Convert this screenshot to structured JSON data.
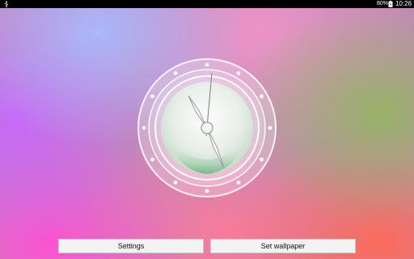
{
  "status_bar": {
    "usb_icon": "usb-icon",
    "battery_percent": "80%",
    "battery_icon": "battery-charging-icon",
    "time": "10:26"
  },
  "clock": {
    "hour_hand_degrees": 330,
    "minute_hand_degrees": 157,
    "second_hand_degrees": 5
  },
  "buttons": {
    "settings_label": "Settings",
    "set_wallpaper_label": "Set wallpaper"
  }
}
